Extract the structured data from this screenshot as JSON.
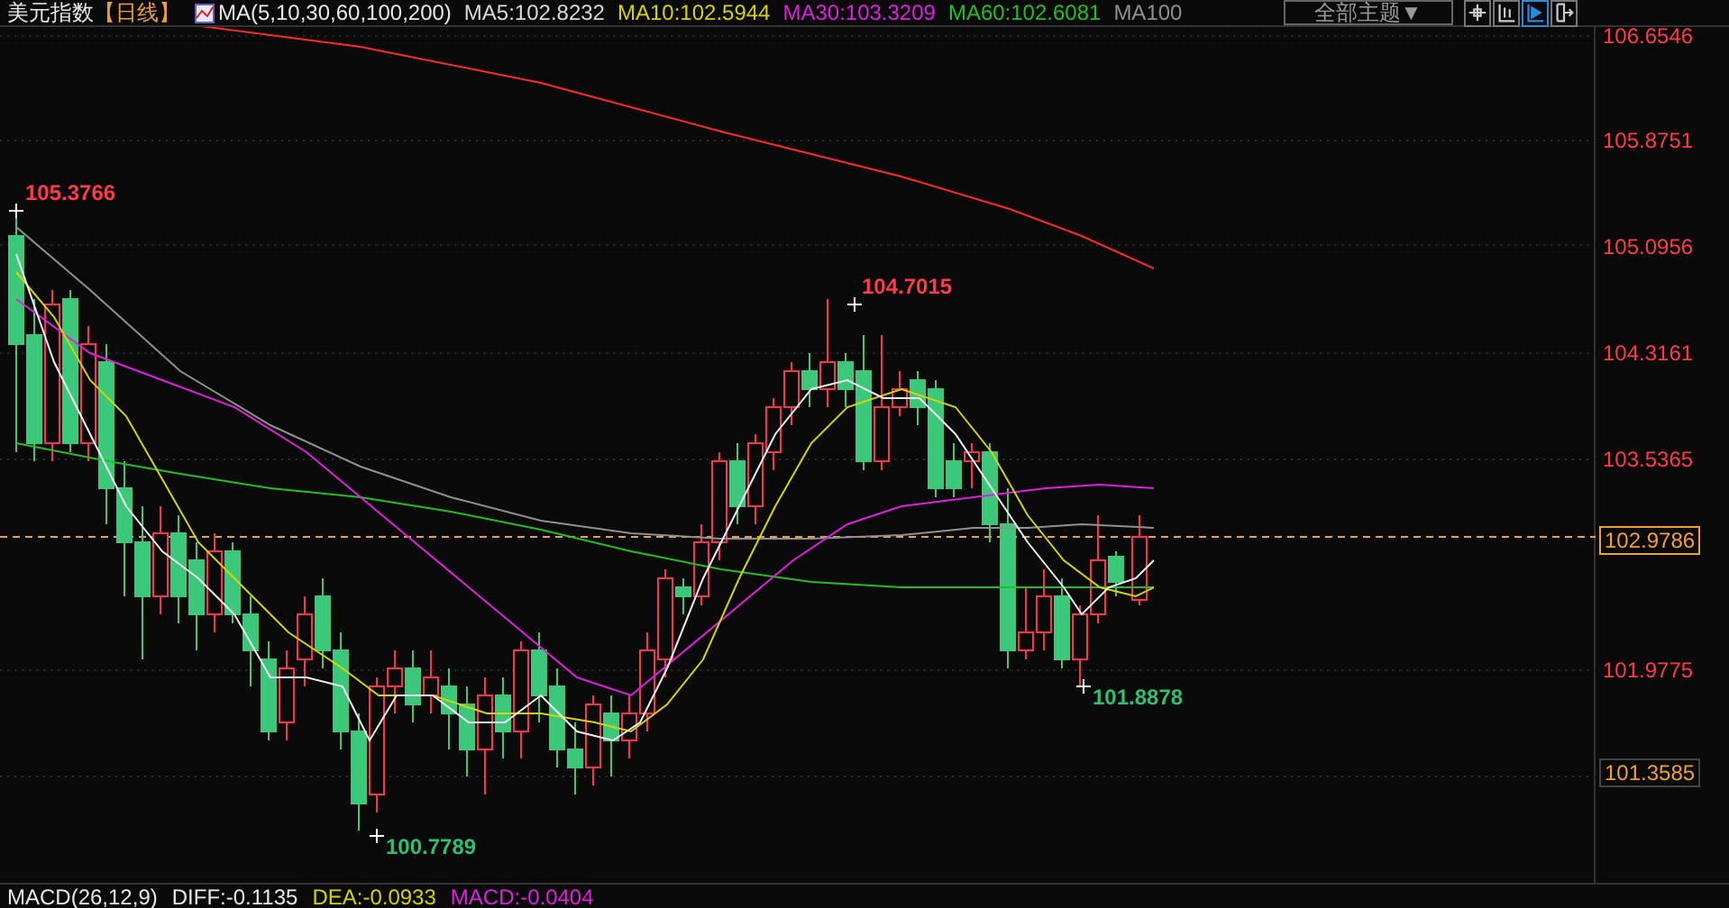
{
  "header": {
    "title": "美元指数",
    "period": "【日线】",
    "indicator": "MA(5,10,30,60,100,200)",
    "legend": [
      {
        "text": "MA5:102.8232",
        "color": "#d8d8d8"
      },
      {
        "text": "MA10:102.5944",
        "color": "#d4d400"
      },
      {
        "text": "MA30:103.3209",
        "color": "#e020e0"
      },
      {
        "text": "MA60:102.6081",
        "color": "#20c020"
      },
      {
        "text": "MA100",
        "color": "#909090"
      }
    ],
    "theme_dropdown": "全部主题▼",
    "toolbar": [
      {
        "kind": "crosshair",
        "selected": false
      },
      {
        "kind": "axis",
        "selected": false
      },
      {
        "kind": "play",
        "selected": true
      },
      {
        "kind": "exit",
        "selected": false
      }
    ]
  },
  "chart": {
    "annotations": [
      {
        "text": "105.3766",
        "kind": "high"
      },
      {
        "text": "104.7015",
        "kind": "high"
      },
      {
        "text": "101.8878",
        "kind": "low"
      },
      {
        "text": "100.7789",
        "kind": "low"
      }
    ]
  },
  "price_axis": [
    {
      "text": "106.6546",
      "kind": "tick"
    },
    {
      "text": "105.8751",
      "kind": "tick"
    },
    {
      "text": "105.0956",
      "kind": "tick"
    },
    {
      "text": "104.3161",
      "kind": "tick"
    },
    {
      "text": "103.5365",
      "kind": "tick"
    },
    {
      "text": "102.9786",
      "kind": "current"
    },
    {
      "text": "101.9775",
      "kind": "tick"
    },
    {
      "text": "101.3585",
      "kind": "cursor"
    }
  ],
  "macd_bar": [
    {
      "text": "MACD(26,12,9)",
      "color": "#e8e8e8"
    },
    {
      "text": "DIFF:-0.1135",
      "color": "#e8e8e8"
    },
    {
      "text": "DEA:-0.0933",
      "color": "#d4d400"
    },
    {
      "text": "MACD:-0.0404",
      "color": "#e020e0"
    }
  ]
}
